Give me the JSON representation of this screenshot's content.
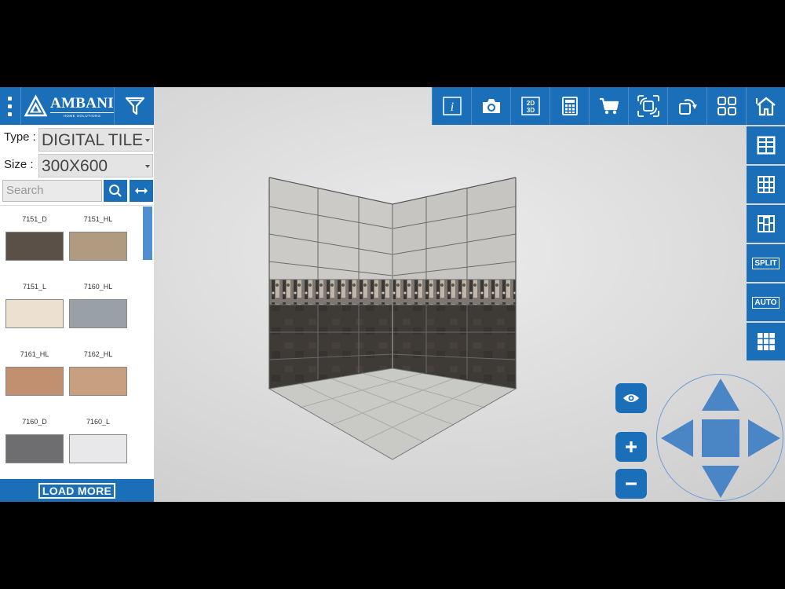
{
  "brand": {
    "name": "AMBANI",
    "tagline": "HOME SOLUTIONS"
  },
  "filters": {
    "type_label": "Type :",
    "type_value": "DIGITAL TILE",
    "size_label": "Size :",
    "size_value": "300X600"
  },
  "search": {
    "placeholder": "Search"
  },
  "tiles": [
    {
      "name": "7151_D",
      "color": "#5a5048"
    },
    {
      "name": "7151_HL",
      "color": "#b09a80"
    },
    {
      "name": "7151_L",
      "color": "#ece0d0"
    },
    {
      "name": "7160_HL",
      "color": "#9aa0a8"
    },
    {
      "name": "7161_HL",
      "color": "#c09070"
    },
    {
      "name": "7162_HL",
      "color": "#c8a080"
    },
    {
      "name": "7160_D",
      "color": "#6e6e70"
    },
    {
      "name": "7160_L",
      "color": "#e8e8ea"
    }
  ],
  "load_more": "LOAD MORE",
  "toolbar": [
    "info-icon",
    "camera-icon",
    "2d-3d-icon",
    "calculator-icon",
    "cart-icon",
    "rotate-view-icon",
    "rotate-icon",
    "grid-layout-icon",
    "home-icon"
  ],
  "toolbar_text": {
    "mode_2d": "2D",
    "mode_3d": "3D"
  },
  "side_tools": {
    "split": "SPLIT",
    "auto": "AUTO"
  },
  "colors": {
    "accent": "#1a6fb8"
  }
}
